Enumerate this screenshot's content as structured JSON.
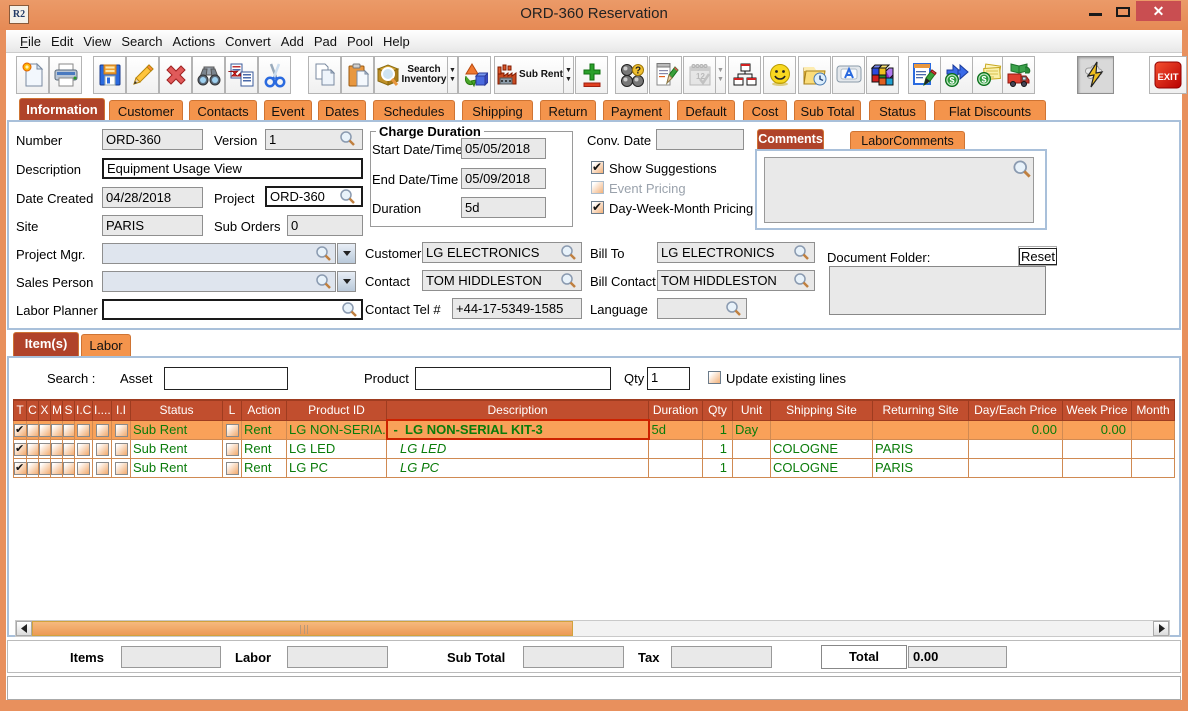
{
  "window": {
    "title": "ORD-360 Reservation",
    "app_icon_text": "R2",
    "close_glyph": "✕"
  },
  "menu": {
    "items": [
      "File",
      "Edit",
      "View",
      "Search",
      "Actions",
      "Convert",
      "Add",
      "Pad",
      "Pool",
      "Help"
    ]
  },
  "toolbar": {
    "dropdown_glyph": "▼",
    "search_inventory_line1": "Search",
    "search_inventory_line2": "Inventory",
    "sub_rent_label": "Sub Rent",
    "exit_label": "EXIT"
  },
  "tabs": {
    "items": [
      "Information",
      "Customer",
      "Contacts",
      "Event",
      "Dates",
      "Schedules",
      "Shipping",
      "Return",
      "Payment",
      "Default",
      "Cost",
      "Sub Total",
      "Status",
      "Flat Discounts"
    ],
    "active": "Information"
  },
  "form": {
    "number_label": "Number",
    "number_value": "ORD-360",
    "version_label": "Version",
    "version_value": "1",
    "description_label": "Description",
    "description_value": "Equipment Usage View",
    "date_created_label": "Date Created",
    "date_created_value": "04/28/2018",
    "project_label": "Project",
    "project_value": "ORD-360",
    "site_label": "Site",
    "site_value": "PARIS",
    "sub_orders_label": "Sub Orders",
    "sub_orders_value": "0",
    "project_mgr_label": "Project Mgr.",
    "project_mgr_value": "",
    "sales_person_label": "Sales Person",
    "sales_person_value": "",
    "labor_planner_label": "Labor Planner",
    "labor_planner_value": ""
  },
  "charge_duration": {
    "title": "Charge Duration",
    "start_label": "Start Date/Time",
    "start_value": "05/05/2018",
    "end_label": "End Date/Time",
    "end_value": "05/09/2018",
    "duration_label": "Duration",
    "duration_value": "5d"
  },
  "options": {
    "conv_date_label": "Conv. Date",
    "conv_date_value": "",
    "show_suggestions_label": "Show Suggestions",
    "show_suggestions_checked": true,
    "event_pricing_label": "Event Pricing",
    "event_pricing_checked": false,
    "dwm_pricing_label": "Day-Week-Month Pricing",
    "dwm_pricing_checked": true
  },
  "comments": {
    "tabs": [
      "Comments",
      "LaborComments"
    ],
    "active": "Comments",
    "value": ""
  },
  "parties": {
    "customer_label": "Customer",
    "customer_value": "LG ELECTRONICS",
    "bill_to_label": "Bill To",
    "bill_to_value": "LG ELECTRONICS",
    "contact_label": "Contact",
    "contact_value": "TOM HIDDLESTON",
    "bill_contact_label": "Bill Contact",
    "bill_contact_value": "TOM HIDDLESTON",
    "contact_tel_label": "Contact Tel #",
    "contact_tel_value": "+44-17-5349-1585",
    "language_label": "Language",
    "language_value": ""
  },
  "document_folder": {
    "label": "Document Folder:",
    "reset_label": "Reset",
    "value": ""
  },
  "items_section": {
    "tabs": [
      "Item(s)",
      "Labor"
    ],
    "active": "Item(s)",
    "search": {
      "search_label": "Search :",
      "asset_label": "Asset",
      "asset_value": "",
      "product_label": "Product",
      "product_value": "",
      "qty_label": "Qty",
      "qty_value": "1",
      "update_lines_label": "Update existing lines",
      "update_lines_checked": false
    },
    "table": {
      "columns": [
        "T",
        "C",
        "X",
        "M",
        "S",
        "I.C",
        "I....",
        "I.I",
        "Status",
        "L",
        "Action",
        "Product ID",
        "Description",
        "Duration",
        "Qty",
        "Unit",
        "Shipping Site",
        "Returning Site",
        "Day/Each Price",
        "Week Price",
        "Month"
      ],
      "rows": [
        {
          "t": true,
          "c": false,
          "x": false,
          "m": false,
          "s": false,
          "ic": false,
          "idot": false,
          "ii": false,
          "status": "Sub Rent",
          "l": false,
          "action": "Rent",
          "product_id": "LG NON-SERIA...",
          "description": "-  LG NON-SERIAL KIT-3",
          "duration": "5d",
          "qty": "1",
          "unit": "Day",
          "shipping_site": "",
          "returning_site": "",
          "day_each_price": "0.00",
          "week_price": "0.00",
          "month": ""
        },
        {
          "t": true,
          "c": false,
          "x": false,
          "m": false,
          "s": false,
          "ic": false,
          "idot": false,
          "ii": false,
          "status": "Sub Rent",
          "l": false,
          "action": "Rent",
          "product_id": "LG LED",
          "description": "LG LED",
          "duration": "",
          "qty": "1",
          "unit": "",
          "shipping_site": "COLOGNE",
          "returning_site": "PARIS",
          "day_each_price": "",
          "week_price": "",
          "month": ""
        },
        {
          "t": true,
          "c": false,
          "x": false,
          "m": false,
          "s": false,
          "ic": false,
          "idot": false,
          "ii": false,
          "status": "Sub Rent",
          "l": false,
          "action": "Rent",
          "product_id": "LG PC",
          "description": "LG PC",
          "duration": "",
          "qty": "1",
          "unit": "",
          "shipping_site": "COLOGNE",
          "returning_site": "PARIS",
          "day_each_price": "",
          "week_price": "",
          "month": ""
        }
      ]
    }
  },
  "totals": {
    "items_label": "Items",
    "items_value": "",
    "labor_label": "Labor",
    "labor_value": "",
    "sub_total_label": "Sub Total",
    "sub_total_value": "",
    "tax_label": "Tax",
    "tax_value": "",
    "total_label": "Total",
    "total_value": "0.00"
  },
  "status_bar": {
    "text": ""
  }
}
